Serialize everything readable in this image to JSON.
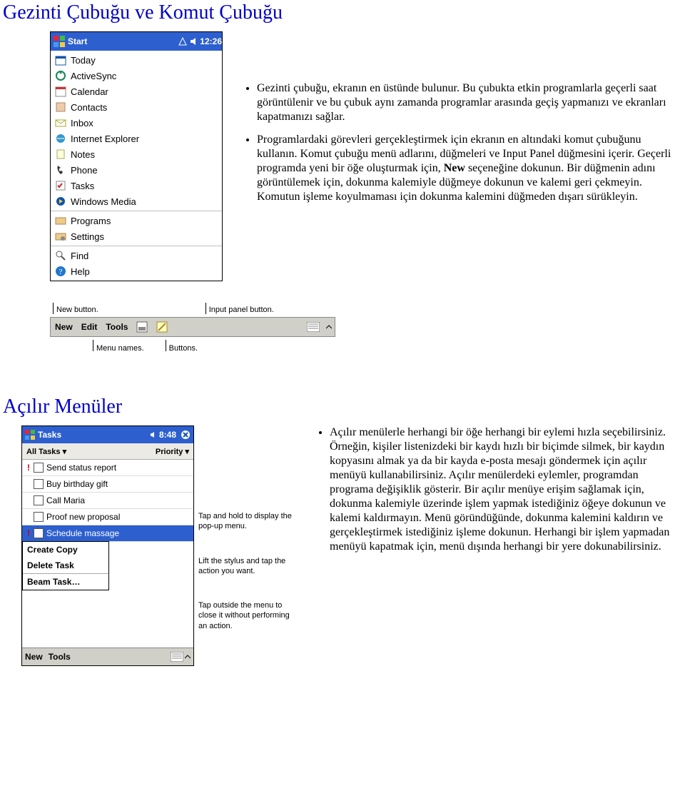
{
  "headings": {
    "section1": "Gezinti Çubuğu ve Komut Çubuğu",
    "section2": "Açılır Menüler"
  },
  "start_menu": {
    "titlebar": {
      "start": "Start",
      "time": "12:26"
    },
    "items": [
      "Today",
      "ActiveSync",
      "Calendar",
      "Contacts",
      "Inbox",
      "Internet Explorer",
      "Notes",
      "Phone",
      "Tasks",
      "Windows Media"
    ],
    "items2": [
      "Programs",
      "Settings"
    ],
    "items3": [
      "Find",
      "Help"
    ]
  },
  "section1_bullets": [
    "Gezinti çubuğu, ekranın en üstünde bulunur. Bu çubukta etkin programlarla geçerli saat görüntülenir ve bu çubuk aynı zamanda programlar arasında geçiş yapmanızı ve ekranları kapatmanızı sağlar.",
    "Programlardaki görevleri gerçekleştirmek için ekranın en altındaki komut çubuğunu kullanın. Komut çubuğu menü adlarını, düğmeleri ve Input Panel düğmesini içerir. Geçerli programda yeni bir öğe oluşturmak için, New seçeneğine dokunun. Bir düğmenin adını görüntülemek için, dokunma kalemiyle düğmeye dokunun ve kalemi geri çekmeyin. Komutun işleme koyulmaması için dokunma kalemini düğmeden dışarı sürükleyin."
  ],
  "bold_new": "New",
  "cmdbar": {
    "annot_top": {
      "new": "New button.",
      "input": "Input panel button."
    },
    "menu": [
      "New",
      "Edit",
      "Tools"
    ],
    "annot_bot": {
      "menus": "Menu names.",
      "buttons": "Buttons."
    }
  },
  "tasks": {
    "title": "Tasks",
    "time": "8:48",
    "sub_left": "All Tasks",
    "sub_right": "Priority",
    "rows": [
      {
        "pri": "!",
        "text": "Send status report"
      },
      {
        "pri": "",
        "text": "Buy birthday gift"
      },
      {
        "pri": "",
        "text": "Call Maria"
      },
      {
        "pri": "",
        "text": "Proof new proposal"
      },
      {
        "pri": "!",
        "text": "Schedule massage",
        "sel": true
      }
    ],
    "popup": [
      "Create Copy",
      "Delete Task",
      "Beam Task…"
    ],
    "cmd": [
      "New",
      "Tools"
    ],
    "annotations": {
      "a1": "Tap and hold to display the pop-up menu.",
      "a2": "Lift the stylus and tap the action you want.",
      "a3": "Tap outside the menu to close it without performing an action."
    }
  },
  "section2_bullet": "Açılır menülerle herhangi bir öğe herhangi bir eylemi hızla seçebilirsiniz. Örneğin, kişiler listenizdeki bir kaydı hızlı bir biçimde silmek, bir kaydın kopyasını almak ya da bir kayda e-posta mesajı göndermek için açılır menüyü kullanabilirsiniz. Açılır menülerdeki eylemler, programdan programa değişiklik gösterir. Bir açılır menüye erişim sağlamak için, dokunma kalemiyle üzerinde işlem yapmak istediğiniz öğeye dokunun ve kalemi kaldırmayın. Menü göründüğünde, dokunma kalemini kaldırın ve gerçekleştirmek istediğiniz işleme dokunun. Herhangi bir işlem yapmadan menüyü kapatmak için, menü dışında herhangi bir yere dokunabilirsiniz."
}
